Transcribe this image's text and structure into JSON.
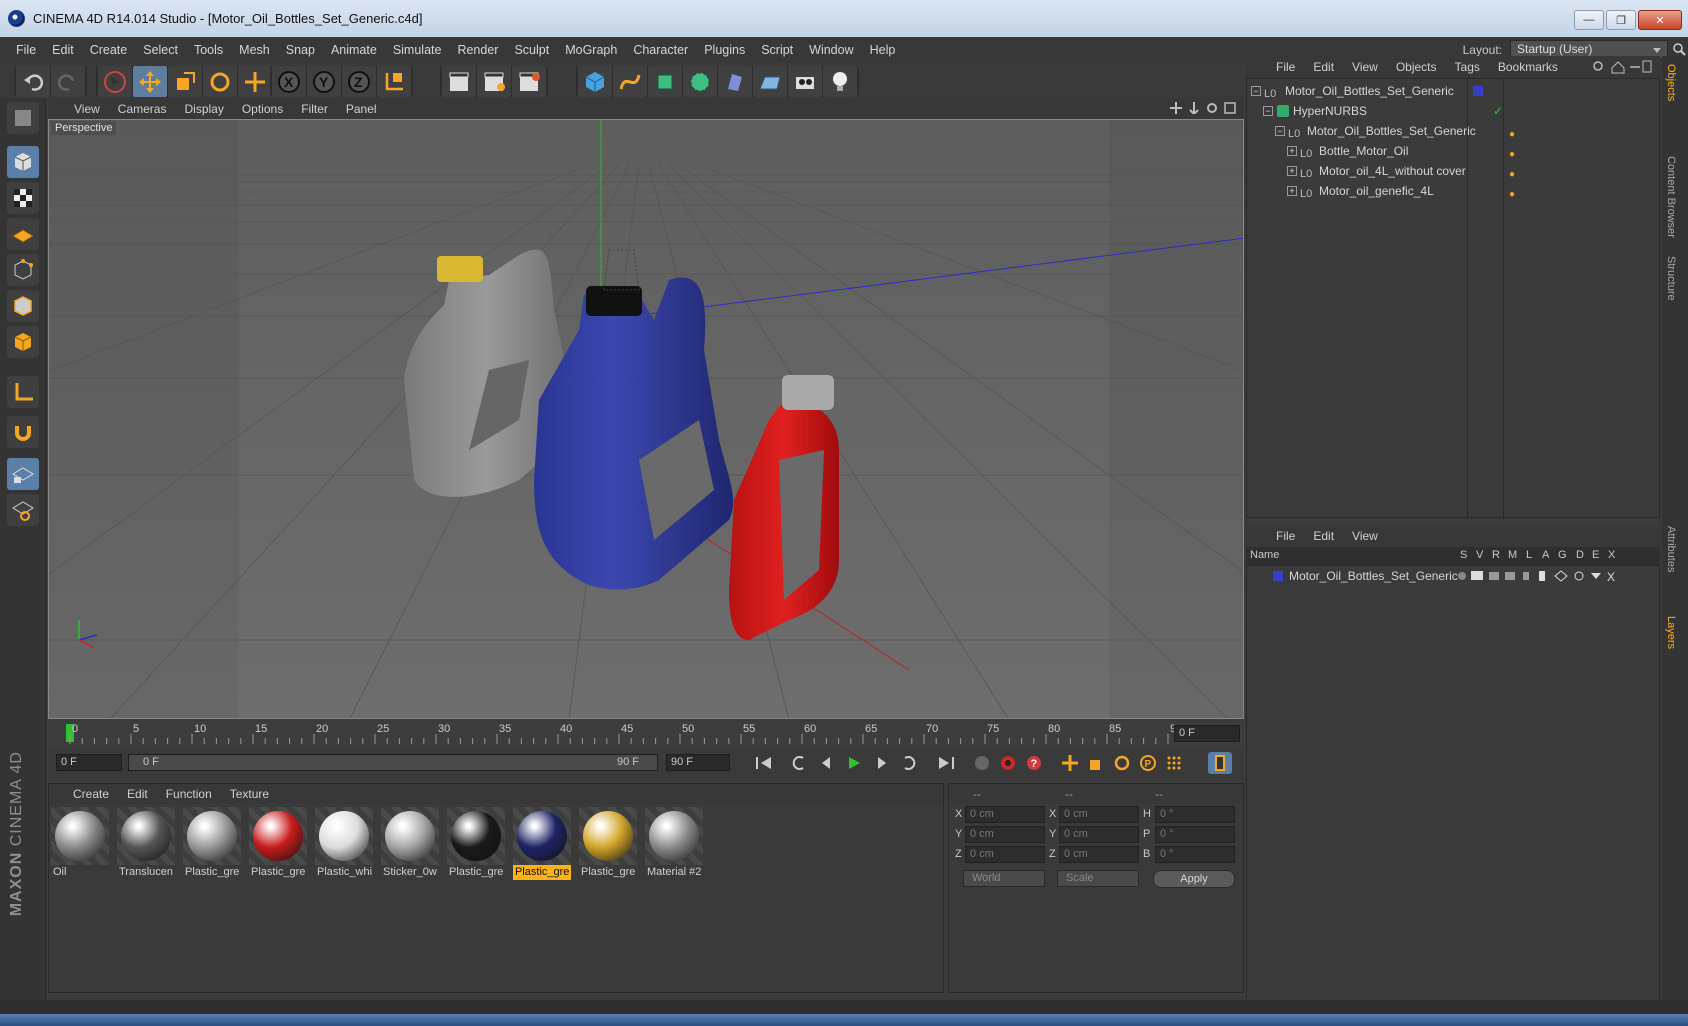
{
  "window": {
    "title": "CINEMA 4D R14.014 Studio - [Motor_Oil_Bottles_Set_Generic.c4d]"
  },
  "menubar": {
    "items": [
      "File",
      "Edit",
      "Create",
      "Select",
      "Tools",
      "Mesh",
      "Snap",
      "Animate",
      "Simulate",
      "Render",
      "Sculpt",
      "MoGraph",
      "Character",
      "Plugins",
      "Script",
      "Window",
      "Help"
    ],
    "layout_label": "Layout:",
    "layout_value": "Startup (User)"
  },
  "viewport": {
    "menu": [
      "View",
      "Cameras",
      "Display",
      "Options",
      "Filter",
      "Panel"
    ],
    "label": "Perspective"
  },
  "timeline": {
    "ticks": [
      "0",
      "5",
      "10",
      "15",
      "20",
      "25",
      "30",
      "35",
      "40",
      "45",
      "50",
      "55",
      "60",
      "65",
      "70",
      "75",
      "80",
      "85",
      "90"
    ],
    "current_frame": "0 F",
    "start_field": "0 F",
    "range_start": "0 F",
    "range_end": "90 F",
    "end_field": "90 F"
  },
  "materials": {
    "menu": [
      "Create",
      "Edit",
      "Function",
      "Texture"
    ],
    "items": [
      {
        "name": "Oil",
        "color": "#8a8a8a",
        "selected": false
      },
      {
        "name": "Translucen",
        "color": "#555555",
        "selected": false
      },
      {
        "name": "Plastic_gre",
        "color": "#9a9a9a",
        "selected": false
      },
      {
        "name": "Plastic_gre",
        "color": "#c81c1c",
        "selected": false
      },
      {
        "name": "Plastic_whi",
        "color": "#dcdcdc",
        "selected": false
      },
      {
        "name": "Sticker_0w",
        "color": "#a8a8a8",
        "selected": false
      },
      {
        "name": "Plastic_gre",
        "color": "#1a1a1a",
        "selected": false
      },
      {
        "name": "Plastic_gre",
        "color": "#1e2466",
        "selected": true
      },
      {
        "name": "Plastic_gre",
        "color": "#d2a52a",
        "selected": false
      },
      {
        "name": "Material #2",
        "color": "#8c8c8c",
        "selected": false
      }
    ]
  },
  "coords": {
    "headers": [
      "--",
      "--",
      "--"
    ],
    "rows": [
      {
        "l1": "X",
        "v1": "0 cm",
        "l2": "X",
        "v2": "0 cm",
        "l3": "H",
        "v3": "0 °"
      },
      {
        "l1": "Y",
        "v1": "0 cm",
        "l2": "Y",
        "v2": "0 cm",
        "l3": "P",
        "v3": "0 °"
      },
      {
        "l1": "Z",
        "v1": "0 cm",
        "l2": "Z",
        "v2": "0 cm",
        "l3": "B",
        "v3": "0 °"
      }
    ],
    "world": "World",
    "scale": "Scale",
    "apply": "Apply"
  },
  "objects": {
    "menu": [
      "File",
      "Edit",
      "View",
      "Objects",
      "Tags",
      "Bookmarks"
    ],
    "tree": [
      "Motor_Oil_Bottles_Set_Generic",
      "HyperNURBS",
      "Motor_Oil_Bottles_Set_Generic",
      "Bottle_Motor_Oil",
      "Motor_oil_4L_without cover",
      "Motor_oil_genefic_4L"
    ]
  },
  "layers": {
    "menu": [
      "File",
      "Edit",
      "View"
    ],
    "columns": [
      "Name",
      "S",
      "V",
      "R",
      "M",
      "L",
      "A",
      "G",
      "D",
      "E",
      "X"
    ],
    "rows": [
      "Motor_Oil_Bottles_Set_Generic"
    ]
  },
  "side_tabs": [
    "Objects",
    "Content Browser",
    "Structure",
    "Attributes",
    "Layers"
  ],
  "branding": {
    "maxon": "MAXON",
    "cinema": "CINEMA 4D"
  }
}
